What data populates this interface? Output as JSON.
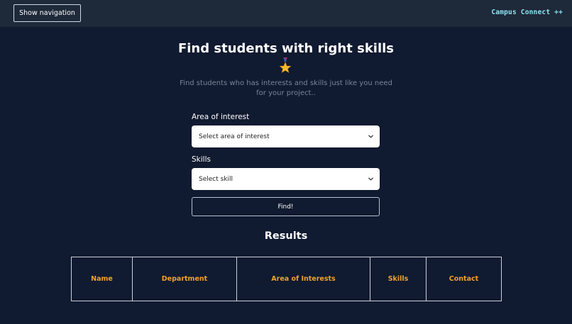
{
  "header": {
    "nav_button_label": "Show navigation",
    "brand": "Campus Connect ++"
  },
  "hero": {
    "title": "Find students with right skills",
    "icon": "military-medal-icon",
    "subtitle": "Find students who has interests and skills just like you need for your project.."
  },
  "form": {
    "interest_label": "Area of interest",
    "interest_selected": "Select area of interest",
    "skills_label": "Skills",
    "skills_selected": "Select skill",
    "find_label": "Find!"
  },
  "results": {
    "title": "Results",
    "columns": [
      "Name",
      "Department",
      "Area of Interests",
      "Skills",
      "Contact"
    ]
  },
  "colors": {
    "background": "#101a30",
    "topbar": "#1e293a",
    "brand": "#8ee3f1",
    "column_header": "#f0a12a"
  }
}
